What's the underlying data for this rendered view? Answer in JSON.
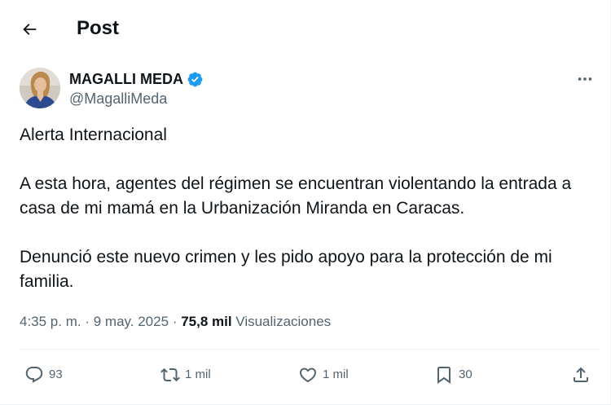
{
  "header": {
    "title": "Post",
    "back_icon": "arrow-left-icon"
  },
  "author": {
    "name": "MAGALLI MEDA",
    "handle": "@MagalliMeda",
    "verified_icon": "verified-badge-icon",
    "verified_color": "#1d9bf0"
  },
  "more_icon": "more-dots-icon",
  "post": {
    "paragraphs": [
      "Alerta Internacional",
      "A esta hora, agentes del régimen se encuentran violentando la entrada a casa de mi mamá en la Urbanización Miranda en Caracas.",
      "Denunció este nuevo crimen y les pido apoyo para la protección de mi familia."
    ]
  },
  "meta": {
    "time": "4:35 p. m.",
    "separator": "·",
    "date": "9 may. 2025",
    "views_count": "75,8 mil",
    "views_label": "Visualizaciones"
  },
  "actions": {
    "reply": {
      "icon": "reply-icon",
      "count": "93"
    },
    "repost": {
      "icon": "repost-icon",
      "count": "1 mil"
    },
    "like": {
      "icon": "heart-icon",
      "count": "1 mil"
    },
    "bookmark": {
      "icon": "bookmark-icon",
      "count": "30"
    },
    "share": {
      "icon": "share-icon"
    }
  },
  "colors": {
    "text_primary": "#0f1419",
    "text_secondary": "#536471",
    "divider": "#eff3f4"
  }
}
